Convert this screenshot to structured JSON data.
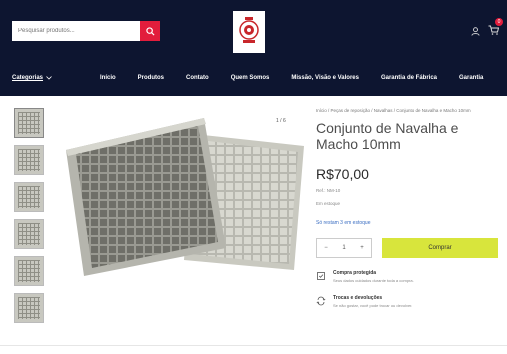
{
  "header": {
    "search_placeholder": "Pesquisar produtos...",
    "cart_count": "0"
  },
  "nav": {
    "categories_label": "Categorias",
    "items": [
      "Início",
      "Produtos",
      "Contato",
      "Quem Somos",
      "Missão, Visão e Valores",
      "Garantia de Fábrica",
      "Garantia"
    ]
  },
  "product": {
    "breadcrumb": "Início / Peças de reposição / Navalhas / Conjunto de Navalha e Macho 10mm",
    "title": "Conjunto de Navalha e Macho 10mm",
    "price": "R$70,00",
    "sku_line": "Ref.: NM-10",
    "stock": "Em estoque",
    "link": "Só restam 3 em estoque",
    "qty": "1",
    "qty_minus": "−",
    "qty_plus": "+",
    "buy_label": "Comprar",
    "zoom_label": "1 / 6",
    "features": [
      {
        "title": "Compra protegida",
        "desc": "Seus dados cuidados durante toda a compra."
      },
      {
        "title": "Trocas e devoluções",
        "desc": "Se não gostar, você pode trocar ou devolver."
      }
    ]
  },
  "colors": {
    "header_bg": "#0d1530",
    "accent_red": "#e21d3c",
    "buy_button": "#d8e53c",
    "link_blue": "#3b6ec2"
  }
}
